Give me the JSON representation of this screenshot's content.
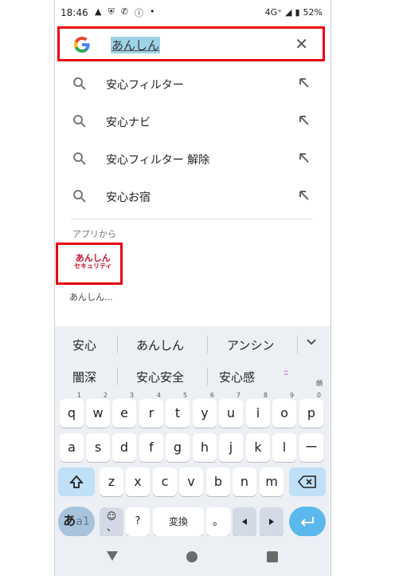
{
  "status_bar": {
    "time": "18:46",
    "network": "4G⁺",
    "battery": "52%"
  },
  "search": {
    "query": "あんしん"
  },
  "suggestions": [
    {
      "text": "安心フィルター"
    },
    {
      "text": "安心ナビ"
    },
    {
      "text": "安心フィルター 解除"
    },
    {
      "text": "安心お宿"
    }
  ],
  "apps_section": {
    "label": "アプリから",
    "app_logo_line1": "あんしん",
    "app_logo_line2": "セキュリティ",
    "app_name": "あんしん..."
  },
  "keyboard": {
    "candidates_row1": [
      "安心",
      "あんしん",
      "アンシン"
    ],
    "candidates_row2": [
      "闇深",
      "安心安全",
      "安心感"
    ],
    "kaomoji_label": "顔",
    "row1": [
      {
        "k": "q",
        "h": "1"
      },
      {
        "k": "w",
        "h": "2"
      },
      {
        "k": "e",
        "h": "3"
      },
      {
        "k": "r",
        "h": "4"
      },
      {
        "k": "t",
        "h": "5"
      },
      {
        "k": "y",
        "h": "6"
      },
      {
        "k": "u",
        "h": "7"
      },
      {
        "k": "i",
        "h": "8"
      },
      {
        "k": "o",
        "h": "9"
      },
      {
        "k": "p",
        "h": "0"
      }
    ],
    "row2": [
      "a",
      "s",
      "d",
      "f",
      "g",
      "h",
      "j",
      "k",
      "l",
      "ー"
    ],
    "row3": [
      "z",
      "x",
      "c",
      "v",
      "b",
      "n",
      "m"
    ],
    "lang_label_a": "あ",
    "lang_label_b": "a1",
    "punct_top": "☺",
    "punct_bottom": "、",
    "question": "?",
    "space_label": "変換",
    "period": "。"
  }
}
